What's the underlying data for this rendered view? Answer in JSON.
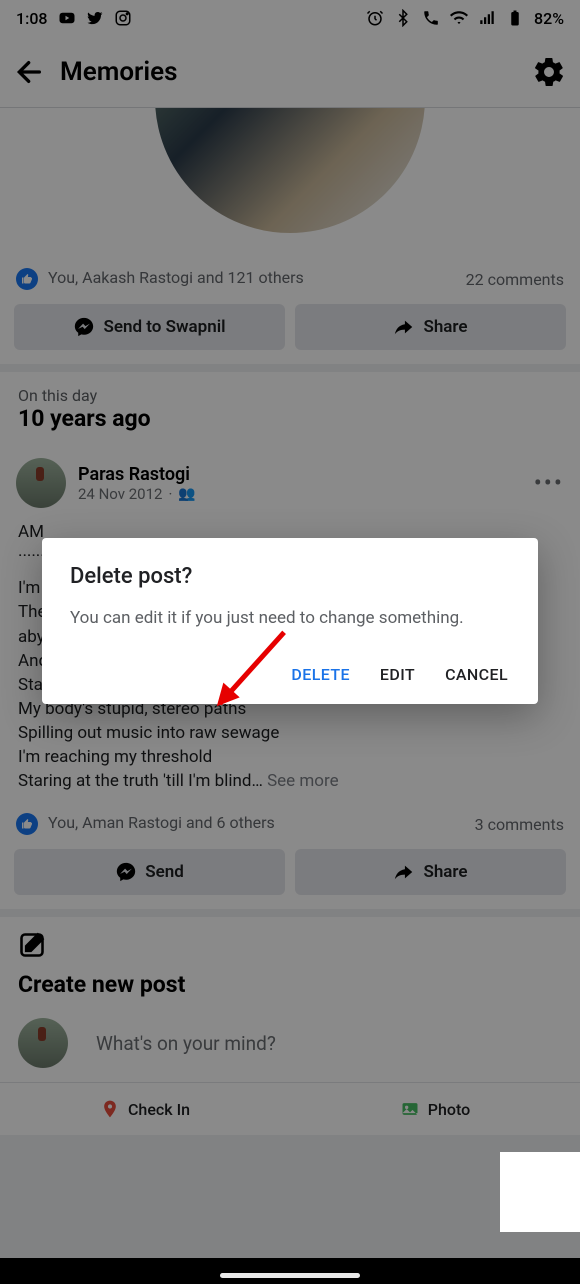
{
  "statusbar": {
    "time": "1:08",
    "battery_pct": "82%"
  },
  "header": {
    "title": "Memories"
  },
  "post1": {
    "reactions_text": "You, Aakash Rastogi and 121 others",
    "comments_text": "22 comments",
    "send_label": "Send to Swapnil",
    "share_label": "Share"
  },
  "dayhead": {
    "sub": "On this day",
    "main": "10 years ago"
  },
  "post2": {
    "author": "Paras Rastogi",
    "date": "24 Nov 2012",
    "body_line1": "AM",
    "body_dots": "·······",
    "body_line2": "I'm",
    "body_line3": "The",
    "body_line4": "aby",
    "body_line5": "And",
    "body_line6": "Sta",
    "body_line7": "My body's stupid, stereo paths",
    "body_line8": "Spilling out music into raw sewage",
    "body_line9": "I'm reaching my threshold",
    "body_line10": "Staring at the truth 'till I'm blind…",
    "see_more": "See more",
    "reactions_text": "You, Aman Rastogi and 6 others",
    "comments_text": "3 comments",
    "send_label": "Send",
    "share_label": "Share"
  },
  "create": {
    "title": "Create new post",
    "prompt": "What's on your mind?",
    "checkin": "Check In",
    "photo": "Photo"
  },
  "dialog": {
    "title": "Delete post?",
    "message": "You can edit it if you just need to change something.",
    "delete": "DELETE",
    "edit": "EDIT",
    "cancel": "CANCEL"
  }
}
